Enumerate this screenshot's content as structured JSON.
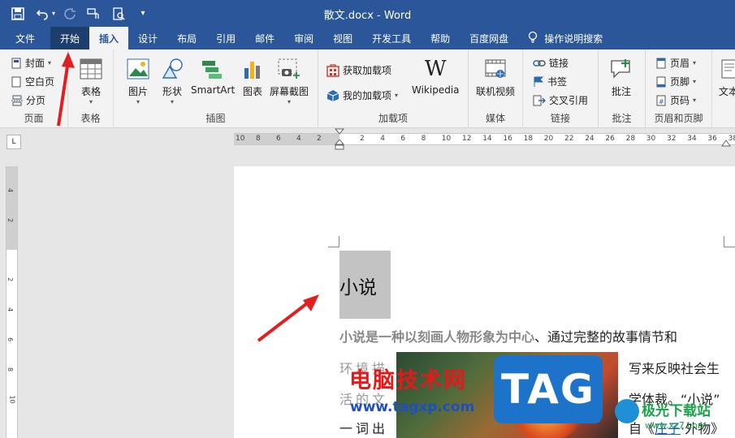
{
  "window": {
    "title": "散文.docx  -  Word"
  },
  "qat": {
    "save": "save-icon",
    "undo": "undo-icon",
    "redo": "redo-icon",
    "touch": "touch-mode-icon",
    "preview": "print-preview-icon",
    "customize": "▾"
  },
  "tabs": [
    "文件",
    "开始",
    "插入",
    "设计",
    "布局",
    "引用",
    "邮件",
    "审阅",
    "视图",
    "开发工具",
    "帮助",
    "百度网盘"
  ],
  "tell_me": "操作说明搜索",
  "ribbon": {
    "pages": {
      "label": "页面",
      "cover": "封面",
      "blank": "空白页",
      "break": "分页"
    },
    "tables": {
      "label": "表格",
      "table": "表格"
    },
    "illustrations": {
      "label": "插图",
      "picture": "图片",
      "shapes": "形状",
      "smartart": "SmartArt",
      "chart": "图表",
      "screenshot": "屏幕截图"
    },
    "addins": {
      "label": "加载项",
      "get": "获取加载项",
      "my": "我的加载项",
      "wiki_glyph": "W",
      "wiki": "Wikipedia"
    },
    "media": {
      "label": "媒体",
      "video": "联机视频"
    },
    "links": {
      "label": "链接",
      "link": "链接",
      "bookmark": "书签",
      "xref": "交叉引用"
    },
    "comments": {
      "label": "批注",
      "comment": "批注"
    },
    "header_footer": {
      "label": "页眉和页脚",
      "header": "页眉",
      "footer": "页脚",
      "page_number": "页码"
    },
    "text": {
      "label": "文本"
    }
  },
  "ruler": {
    "corner": "L",
    "h_numbers": [
      "10",
      "8",
      "6",
      "4",
      "2",
      "2",
      "4",
      "6",
      "8",
      "10",
      "12",
      "14",
      "16",
      "18",
      "20",
      "22",
      "24",
      "26",
      "28",
      "30",
      "32",
      "34",
      "36",
      "38"
    ],
    "v_numbers": [
      "4",
      "2",
      "2",
      "4",
      "6",
      "8",
      "10"
    ]
  },
  "document": {
    "heading": "小说",
    "line1_bold": "小说是一种以刻画人物形象为中心",
    "line1_rest": "、通过完整的故事情节和",
    "line2_left": "环境描",
    "line2_right": "写来反映社会生",
    "line3_left": "活的文",
    "line3_right": "学体裁。“小说”",
    "line4_left": "一词出",
    "line4_right_a": "自《",
    "line4_link": "庄子",
    "line4_right_b": "·外物》"
  },
  "watermarks": {
    "cn": "电脑技术网",
    "url": "www.tagxp.com",
    "tag": "TAG",
    "site": "极光下载站",
    "site_url": "www.xz7.com"
  }
}
